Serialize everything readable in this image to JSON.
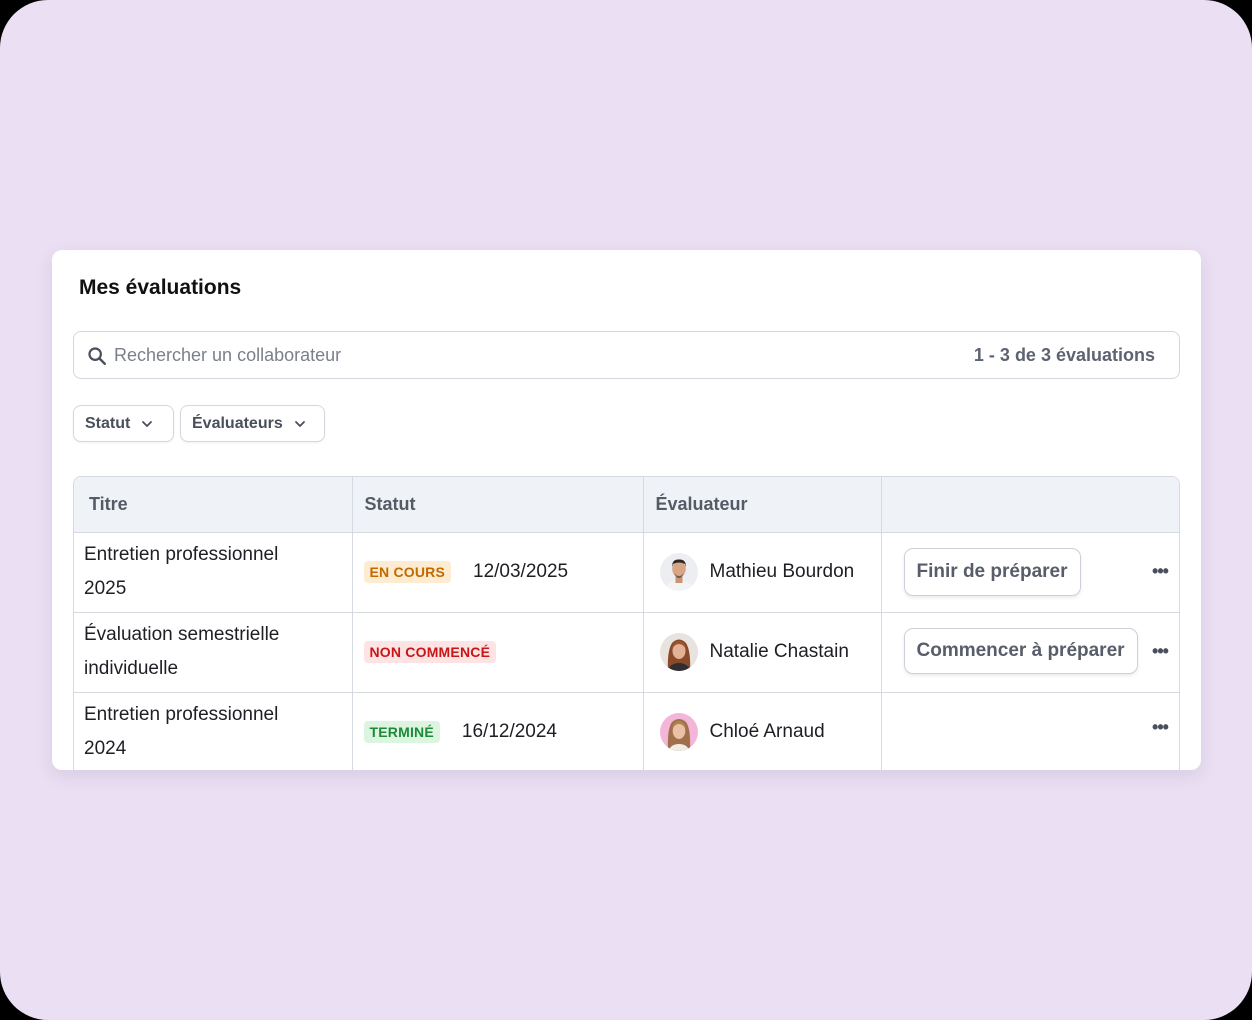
{
  "page": {
    "background": "#ebdff3"
  },
  "card": {
    "title": "Mes évaluations"
  },
  "search": {
    "placeholder": "Rechercher un collaborateur",
    "value": "",
    "count": "1 - 3 de 3 évaluations"
  },
  "filters": [
    {
      "label": "Statut"
    },
    {
      "label": "Évaluateurs"
    }
  ],
  "table": {
    "headers": [
      "Titre",
      "Statut",
      "Évaluateur",
      ""
    ],
    "rows": [
      {
        "title_line1": "Entretien professionnel",
        "title_line2": "2025",
        "status": "EN COURS",
        "status_color": "#c26a00",
        "date": "12/03/2025",
        "evaluator": "Mathieu Bourdon",
        "action": "Finir de préparer",
        "more": "•••"
      },
      {
        "title_line1": "Évaluation semestrielle",
        "title_line2": "individuelle",
        "status": "NON COMMENCÉ",
        "status_color": "#c51717",
        "date": "",
        "evaluator": "Natalie Chastain",
        "action": "Commencer à préparer",
        "more": "•••"
      },
      {
        "title_line1": "Entretien professionnel",
        "title_line2": "2024",
        "status": "TERMINÉ",
        "status_color": "#1e8a38",
        "date": "16/12/2024",
        "evaluator": "Chloé Arnaud",
        "action": "",
        "more": "•••"
      }
    ]
  }
}
